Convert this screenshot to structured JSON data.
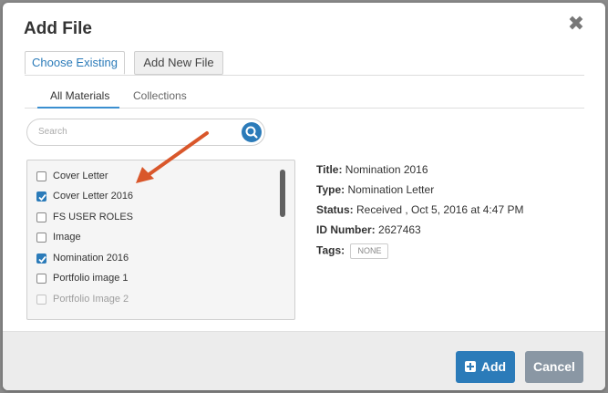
{
  "dialog": {
    "title": "Add File",
    "close_icon": "close-icon"
  },
  "tabs": {
    "choose_existing": "Choose Existing",
    "add_new_file": "Add New File"
  },
  "sub_tabs": {
    "all_materials": "All Materials",
    "collections": "Collections"
  },
  "search": {
    "placeholder": "Search",
    "icon": "search-icon"
  },
  "materials": [
    {
      "label": "Cover Letter",
      "checked": false
    },
    {
      "label": "Cover Letter 2016",
      "checked": true
    },
    {
      "label": "FS USER ROLES",
      "checked": false
    },
    {
      "label": "Image",
      "checked": false
    },
    {
      "label": "Nomination 2016",
      "checked": true
    },
    {
      "label": "Portfolio image 1",
      "checked": false
    },
    {
      "label": "Portfolio Image 2",
      "checked": false
    }
  ],
  "details": {
    "title_label": "Title:",
    "title_value": "Nomination 2016",
    "type_label": "Type:",
    "type_value": "Nomination Letter",
    "status_label": "Status:",
    "status_value": "Received , Oct 5, 2016 at 4:47 PM",
    "id_label": "ID Number:",
    "id_value": "2627463",
    "tags_label": "Tags:",
    "tags_value": "NONE"
  },
  "footer": {
    "add_label": "Add",
    "cancel_label": "Cancel"
  },
  "colors": {
    "accent": "#2b7bb9",
    "arrow": "#d9572b",
    "cancel": "#8a97a4"
  }
}
